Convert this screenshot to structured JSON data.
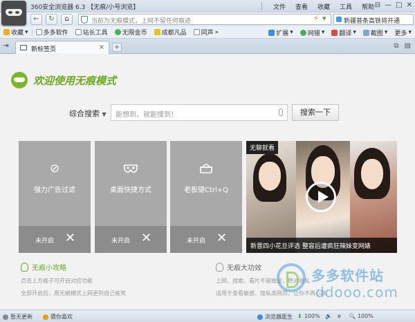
{
  "window": {
    "title": "360安全浏览器 6.3 【无痕/小号浏览】",
    "menu": [
      "文件",
      "查看",
      "收藏",
      "工具",
      "帮助"
    ],
    "controls": [
      "⊟",
      "—",
      "□",
      "✕"
    ]
  },
  "addressbar": {
    "placeholder": "当前为无痕模式，上网不留任何痕迹",
    "search_value": "新疆普条高铁将开通"
  },
  "bookmarks": {
    "items": [
      "收藏",
      "多多软件",
      "站长工具",
      "无限金币",
      "成都凡品",
      "同声"
    ],
    "right_items": [
      "扩展",
      "网银",
      "翻译",
      "截图",
      "更多"
    ]
  },
  "tabbar": {
    "active_tab": "新标签页",
    "new_tab": "+",
    "close": "×"
  },
  "page": {
    "brand_title": "欢迎使用无痕模式",
    "search_label": "综合搜索",
    "search_placeholder": "能想到，就能搜到！",
    "search_button": "搜索一下",
    "cards": [
      {
        "title": "强力广告过滤",
        "state": "未开启",
        "icon": "🚫"
      },
      {
        "title": "桌面快捷方式",
        "state": "未开启",
        "icon": "mask"
      },
      {
        "title": "老板键Ctrl+Q",
        "state": "未开启",
        "icon": "boss"
      }
    ],
    "video": {
      "tag": "无聊就看",
      "caption": "新晋四小花旦评选 整容后遭疯狂辣妹变网婊"
    },
    "tips_left": {
      "title": "无痕小攻略",
      "lines": [
        "点击上方格子可开启对应功能",
        "全部开启后，用无痕模式上网更到自己偷笑"
      ]
    },
    "tips_right": {
      "title": "无痕大功效",
      "lines": [
        "上网、搜索、看片不留痕迹，绝对隐私",
        "适用于查看敏感、隐私类网页，让你不再心跳"
      ]
    },
    "watermark": {
      "line1": "多多软件站",
      "line2": "ddooo.com"
    }
  },
  "statusbar": {
    "left1": "暂无更新",
    "left2": "猜你喜欢",
    "doctor": "浏览器医生",
    "download": "100%",
    "zoom": "100%"
  },
  "colors": {
    "accent_green": "#6aaa1e",
    "card_gray": "#a9a9a9",
    "card_foot": "#8c8c8c"
  }
}
